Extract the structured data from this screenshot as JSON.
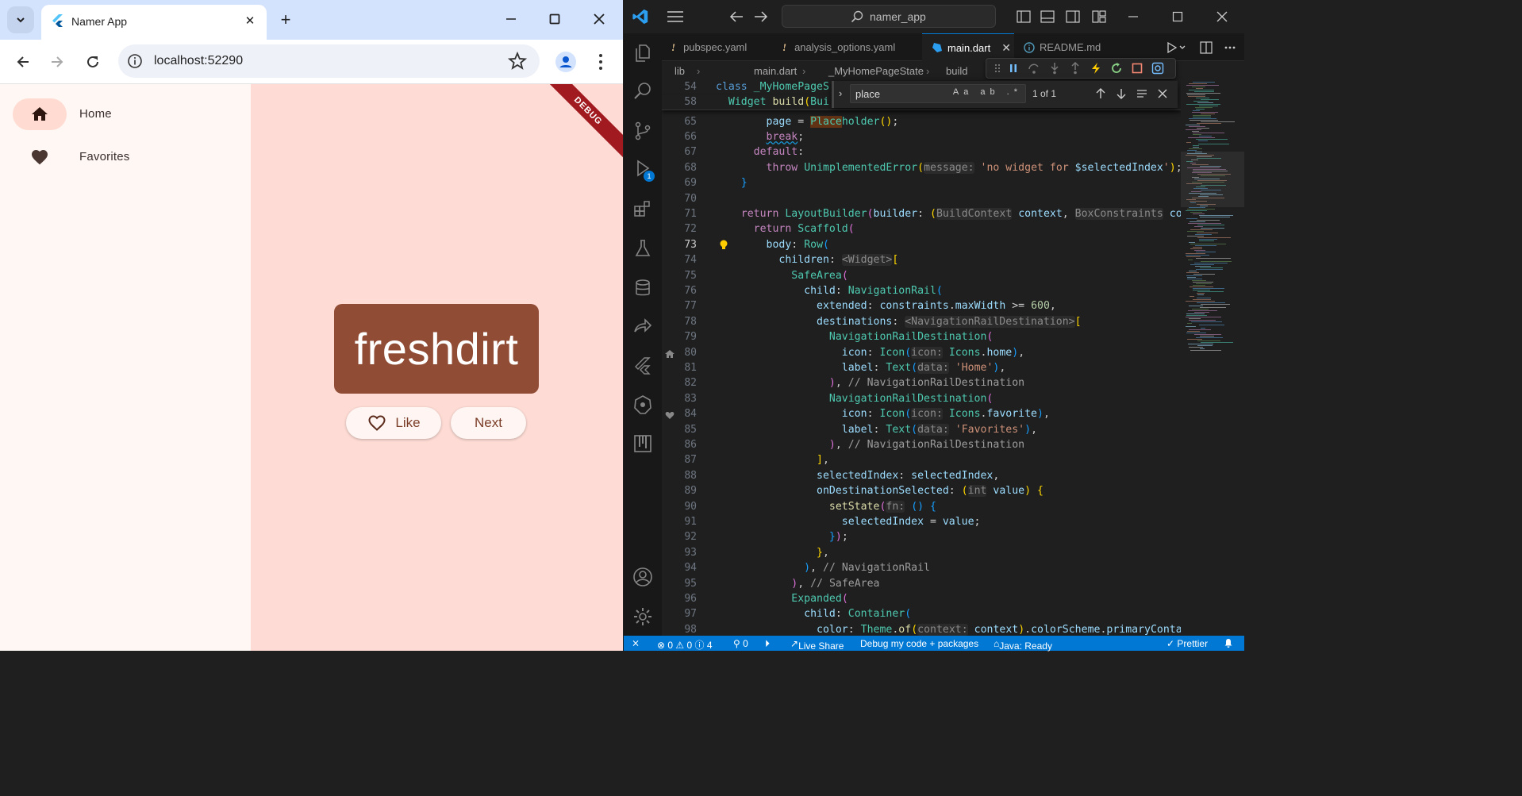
{
  "browser": {
    "tab_title": "Namer App",
    "tab_close_glyph": "✕",
    "new_tab_glyph": "+",
    "url": "localhost:52290",
    "icons": [
      "tab-search-icon",
      "flutter-favicon",
      "minimize-icon",
      "maximize-icon",
      "close-icon",
      "back-arrow-icon",
      "forward-arrow-icon",
      "reload-icon",
      "site-info-icon",
      "bookmark-star-icon",
      "profile-icon",
      "more-menu-icon"
    ]
  },
  "app": {
    "rail": [
      {
        "label": "Home",
        "icon": "home-icon",
        "selected": true
      },
      {
        "label": "Favorites",
        "icon": "favorite-icon",
        "selected": false
      }
    ],
    "debug_banner": "DEBUG",
    "word_pair": "freshdirt",
    "like_label": "Like",
    "next_label": "Next",
    "colors": {
      "card": "#914c35",
      "background": "#fedcd5",
      "rail": "#fff7f4",
      "rail_selected": "#ffdbd1"
    }
  },
  "vscode": {
    "search": "namer_app",
    "tabs": [
      {
        "label": "pubspec.yaml",
        "warn": "!"
      },
      {
        "label": "analysis_options.yaml",
        "warn": "!"
      },
      {
        "label": "main.dart",
        "active": true,
        "close": "✕"
      },
      {
        "label": "README.md"
      }
    ],
    "breadcrumb": [
      "lib",
      "main.dart",
      "_MyHomePageState",
      "build"
    ],
    "find": {
      "query": "place",
      "options": "Aa ab .*",
      "count": "1 of 1"
    },
    "debug_badge": "1",
    "status": {
      "remote": "⨯",
      "problems": "⊗ 0 ⚠ 0 ⓘ 4",
      "ports": "⚲ 0",
      "liveshare": "Live Share",
      "debug": "Debug my code + packages",
      "java": "Java: Ready",
      "prettier": "✓ Prettier",
      "bell": "🔔"
    }
  }
}
